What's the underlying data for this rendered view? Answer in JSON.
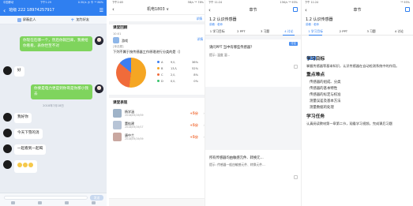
{
  "screen1": {
    "status": {
      "carrier": "中国移动",
      "time": "下午1:29",
      "right": "0.5K/s ◔ 令 ⁹⁴ 86%"
    },
    "nav": {
      "back": "‹",
      "title": "班级 222 18974257917",
      "menu": "☰"
    },
    "tabs": [
      {
        "label": "屏蔽此人",
        "icon": "block-icon"
      },
      {
        "label": "加为好友",
        "icon": "add-friend-icon"
      }
    ],
    "messages": [
      {
        "side": "right",
        "style": "green",
        "text": "你现在在哪一个，然后你就回来，我要给你看看，表你世至不对"
      },
      {
        "side": "left",
        "style": "white",
        "text": "好"
      },
      {
        "side": "right",
        "style": "green",
        "text": "你要是电力更是到你哥是你那小我去"
      },
      {
        "side": "left",
        "style": "white",
        "text": "我好你"
      },
      {
        "side": "left",
        "style": "white",
        "text": "今天下雪的消"
      },
      {
        "side": "left",
        "style": "white",
        "text": "一起看到一起喝"
      },
      {
        "side": "left",
        "style": "emoji",
        "text": ""
      }
    ],
    "timestamp": "2018年7月18日",
    "input": {
      "send": "发送"
    }
  },
  "screen2": {
    "status": {
      "time": "下午2:05",
      "right": "5B/s ⁹⁴ 78%"
    },
    "nav": {
      "back": "‹",
      "title": "机电1803 ∨"
    },
    "top_link": "详情",
    "review": {
      "heading": "课堂回顾",
      "time": "10:01",
      "poster": "游戏",
      "link": "详情",
      "tag": "[单选题]",
      "question": "下列不属于按传感器工作原理进行分类的是（）"
    },
    "legend": [
      {
        "label": "A",
        "count": "9人",
        "pct": "36%",
        "color": "#3d7ef0"
      },
      {
        "label": "B",
        "count": "13人",
        "pct": "52%",
        "color": "#f5a623"
      },
      {
        "label": "C",
        "count": "2人",
        "pct": "8%",
        "color": "#f06b3a"
      },
      {
        "label": "D",
        "count": "0人",
        "pct": "0%",
        "color": "#37c46b"
      }
    ],
    "performance": {
      "title": "课堂表现",
      "rows": [
        {
          "name": "杨学涵",
          "time": "2018/09/19/09",
          "score": "+5分"
        },
        {
          "name": "董桂建",
          "time": "2018/09/19/17",
          "score": "+5分"
        },
        {
          "name": "唐中兰",
          "time": "2018/09/19/09",
          "score": "+5分"
        }
      ]
    }
  },
  "screen3": {
    "status": {
      "time": "下午 11:24",
      "right": "15K/s ⁹⁴ 95%"
    },
    "nav": {
      "back": "‹",
      "title": "章节"
    },
    "course": "1.2 认识传感器",
    "meta": "讲稿 · 老师",
    "tabs": [
      "1 学习目标",
      "2 PPT",
      "3 习题",
      "4 讨论"
    ],
    "active_tab": 3,
    "card1": {
      "question": "请问PPT 当中有哪些传感器？",
      "answer": "提示: 温度 湿…",
      "badge": "讨论"
    },
    "card2": {
      "question": "所有传感器均由敏感元件、转换元…",
      "answer": "提示: 传感器一般由敏感元件、转换元件…"
    }
  },
  "screen4": {
    "status": {
      "time": "下午 11:24",
      "right": "⁹⁴ 95%"
    },
    "nav": {
      "back": "‹",
      "title": "章节"
    },
    "course": "1.2 认识传感器",
    "meta": "讲稿 · 老师",
    "tabs": [
      "1 学习目标",
      "2 PPT",
      "3 习题",
      "4 讨论"
    ],
    "badge": "讨论",
    "goal_title": "学习目标",
    "goal_text": "掌握传感器等基本知识，认识传感器在自动检测系统中的作用。",
    "key_title": "重点难点",
    "key_items": [
      "传感器的组成、分类",
      "传感器的基本特性",
      "传感器的标定与校准",
      "测量误差及基本方法",
      "测量数据的处理"
    ],
    "task_title": "学习任务",
    "task_text": "认真阅读教材第一章第二节，观看学习视频，完成课后习题"
  }
}
